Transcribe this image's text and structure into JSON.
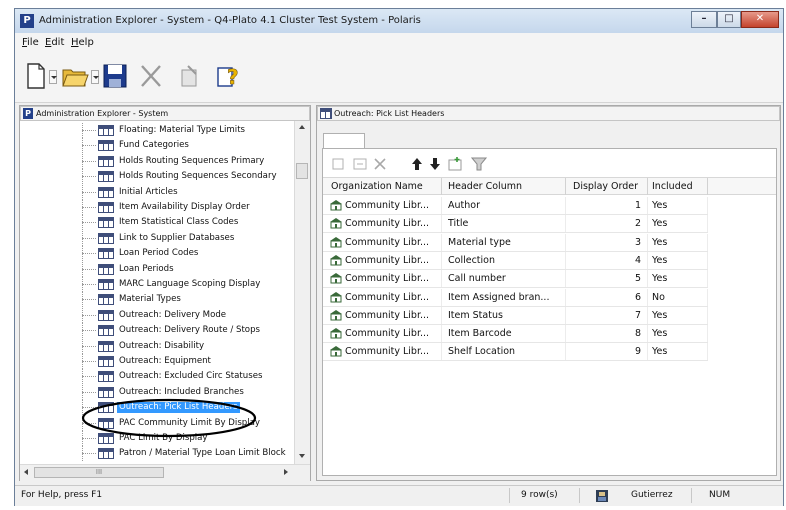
{
  "window": {
    "title": "Administration Explorer - System - Q4-Plato 4.1 Cluster Test System - Polaris",
    "app_icon_letter": "P",
    "controls": {
      "minimize": "–",
      "maximize": "□",
      "close": "✕"
    }
  },
  "menu": [
    "File",
    "Edit",
    "Help"
  ],
  "toolbar_icons": [
    "new-document-icon",
    "open-folder-icon",
    "save-icon",
    "delete-icon",
    "properties-icon",
    "help-icon"
  ],
  "left_pane": {
    "header_icon": "P",
    "title": "Administration Explorer - System",
    "items": [
      "Floating: Material Type Limits",
      "Fund Categories",
      "Holds Routing Sequences Primary",
      "Holds Routing Sequences Secondary",
      "Initial Articles",
      "Item Availability Display Order",
      "Item Statistical Class Codes",
      "Link to Supplier Databases",
      "Loan Period Codes",
      "Loan Periods",
      "MARC Language Scoping Display",
      "Material Types",
      "Outreach: Delivery Mode",
      "Outreach: Delivery Route / Stops",
      "Outreach: Disability",
      "Outreach: Equipment",
      "Outreach: Excluded Circ Statuses",
      "Outreach: Included Branches",
      "Outreach: Pick List Headers",
      "PAC Community Limit By Display",
      "PAC Limit By Display",
      "Patron / Material Type Loan Limit Block"
    ],
    "selected_index": 18,
    "hscroll_label": "III"
  },
  "right_pane": {
    "title": "Outreach: Pick List Headers",
    "grid_toolbar_icons": [
      "new-row-icon",
      "edit-row-icon",
      "delete-row-icon",
      "move-up-icon",
      "move-down-icon",
      "insert-icon",
      "filter-icon"
    ],
    "columns": [
      "Organization Name",
      "Header Column",
      "Display Order",
      "Included"
    ],
    "rows": [
      {
        "org": "Community Libr...",
        "header": "Author",
        "order": "1",
        "included": "Yes"
      },
      {
        "org": "Community Libr...",
        "header": "Title",
        "order": "2",
        "included": "Yes"
      },
      {
        "org": "Community Libr...",
        "header": "Material type",
        "order": "3",
        "included": "Yes"
      },
      {
        "org": "Community Libr...",
        "header": "Collection",
        "order": "4",
        "included": "Yes"
      },
      {
        "org": "Community Libr...",
        "header": "Call number",
        "order": "5",
        "included": "Yes"
      },
      {
        "org": "Community Libr...",
        "header": "Item Assigned bran...",
        "order": "6",
        "included": "No"
      },
      {
        "org": "Community Libr...",
        "header": "Item Status",
        "order": "7",
        "included": "Yes"
      },
      {
        "org": "Community Libr...",
        "header": "Item Barcode",
        "order": "8",
        "included": "Yes"
      },
      {
        "org": "Community Libr...",
        "header": "Shelf Location",
        "order": "9",
        "included": "Yes"
      }
    ]
  },
  "status": {
    "help_text": "For Help, press F1",
    "rows": "9 row(s)",
    "user": "Gutierrez",
    "num": "NUM"
  },
  "colors": {
    "selection": "#3399ff",
    "title_bar": "#c5d7ec",
    "annotation_circle": "#000000"
  }
}
